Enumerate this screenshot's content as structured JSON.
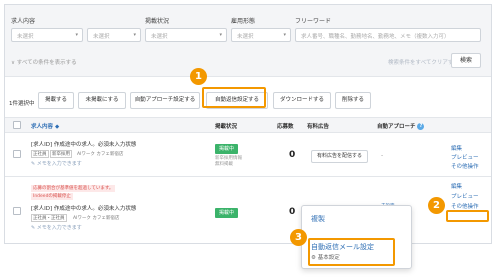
{
  "filters": {
    "job_content_label": "求人内容",
    "job_content_placeholder": "未選択",
    "posting_status_label": "掲載状況",
    "posting_status_placeholder": "未選択",
    "employment_type_label": "雇用形態",
    "employment_type_placeholder": "未選択",
    "freeword_label": "フリーワード",
    "freeword_placeholder": "求人番号、職種名、勤務地名、勤務地、メモ（複数入力可）",
    "all_conditions_link": "すべての条件を表示する",
    "clear_all_link": "検索条件をすべてクリアする",
    "search_button": "検索"
  },
  "toolbar": {
    "selected_count": "1件選択中",
    "publish": "掲載する",
    "unpublish": "未掲載にする",
    "auto_approach": "自動アプローチ設定する",
    "auto_reply": "自動返信設定する",
    "download": "ダウンロードする",
    "delete": "削除する"
  },
  "table": {
    "headers": {
      "job_content": "求人内容",
      "job_content_sort": "◆",
      "posting_status": "掲載状況",
      "applications": "応募数",
      "paid_ads": "有料広告",
      "auto_approach": "自動アプローチ"
    },
    "rows": [
      {
        "title": "[求人ID] 作成途中の求人。必須未入力状態",
        "tags": [
          "正社員",
          "新卒採用"
        ],
        "meta": "AIワーク カフェ新宿店",
        "memo": "メモを入力できます",
        "status": "掲載中",
        "substatus_1": "新卒採用情報",
        "substatus_2": "無料掲載",
        "applications": "0",
        "ad_button": "有料広告を配信する",
        "approach": "-",
        "actions": [
          "編集",
          "プレビュー",
          "その他操作"
        ]
      },
      {
        "warning_1": "応募の割合が基準値を超過しています。",
        "warning_2": "Indeedの掲載停止",
        "title": "[求人ID] 作成途中の求人。必須未入力状態",
        "tags": [
          "正社員・正社員"
        ],
        "meta": "AIワーク カフェ新宿店",
        "memo": "メモを入力できます",
        "status": "掲載中",
        "applications": "0",
        "approach_tag": "未設定",
        "approach_tag_2": "設定中",
        "actions": [
          "編集",
          "プレビュー",
          "その他操作"
        ]
      }
    ]
  },
  "popup": {
    "copy": "複製",
    "auto_reply_mail": "自動返信メール設定",
    "basic_settings": "基本設定"
  },
  "callouts": [
    "1",
    "2",
    "3"
  ],
  "colors": {
    "highlight": "#f39800",
    "status_green": "#3bb36a",
    "link_blue": "#2f6fb5"
  }
}
